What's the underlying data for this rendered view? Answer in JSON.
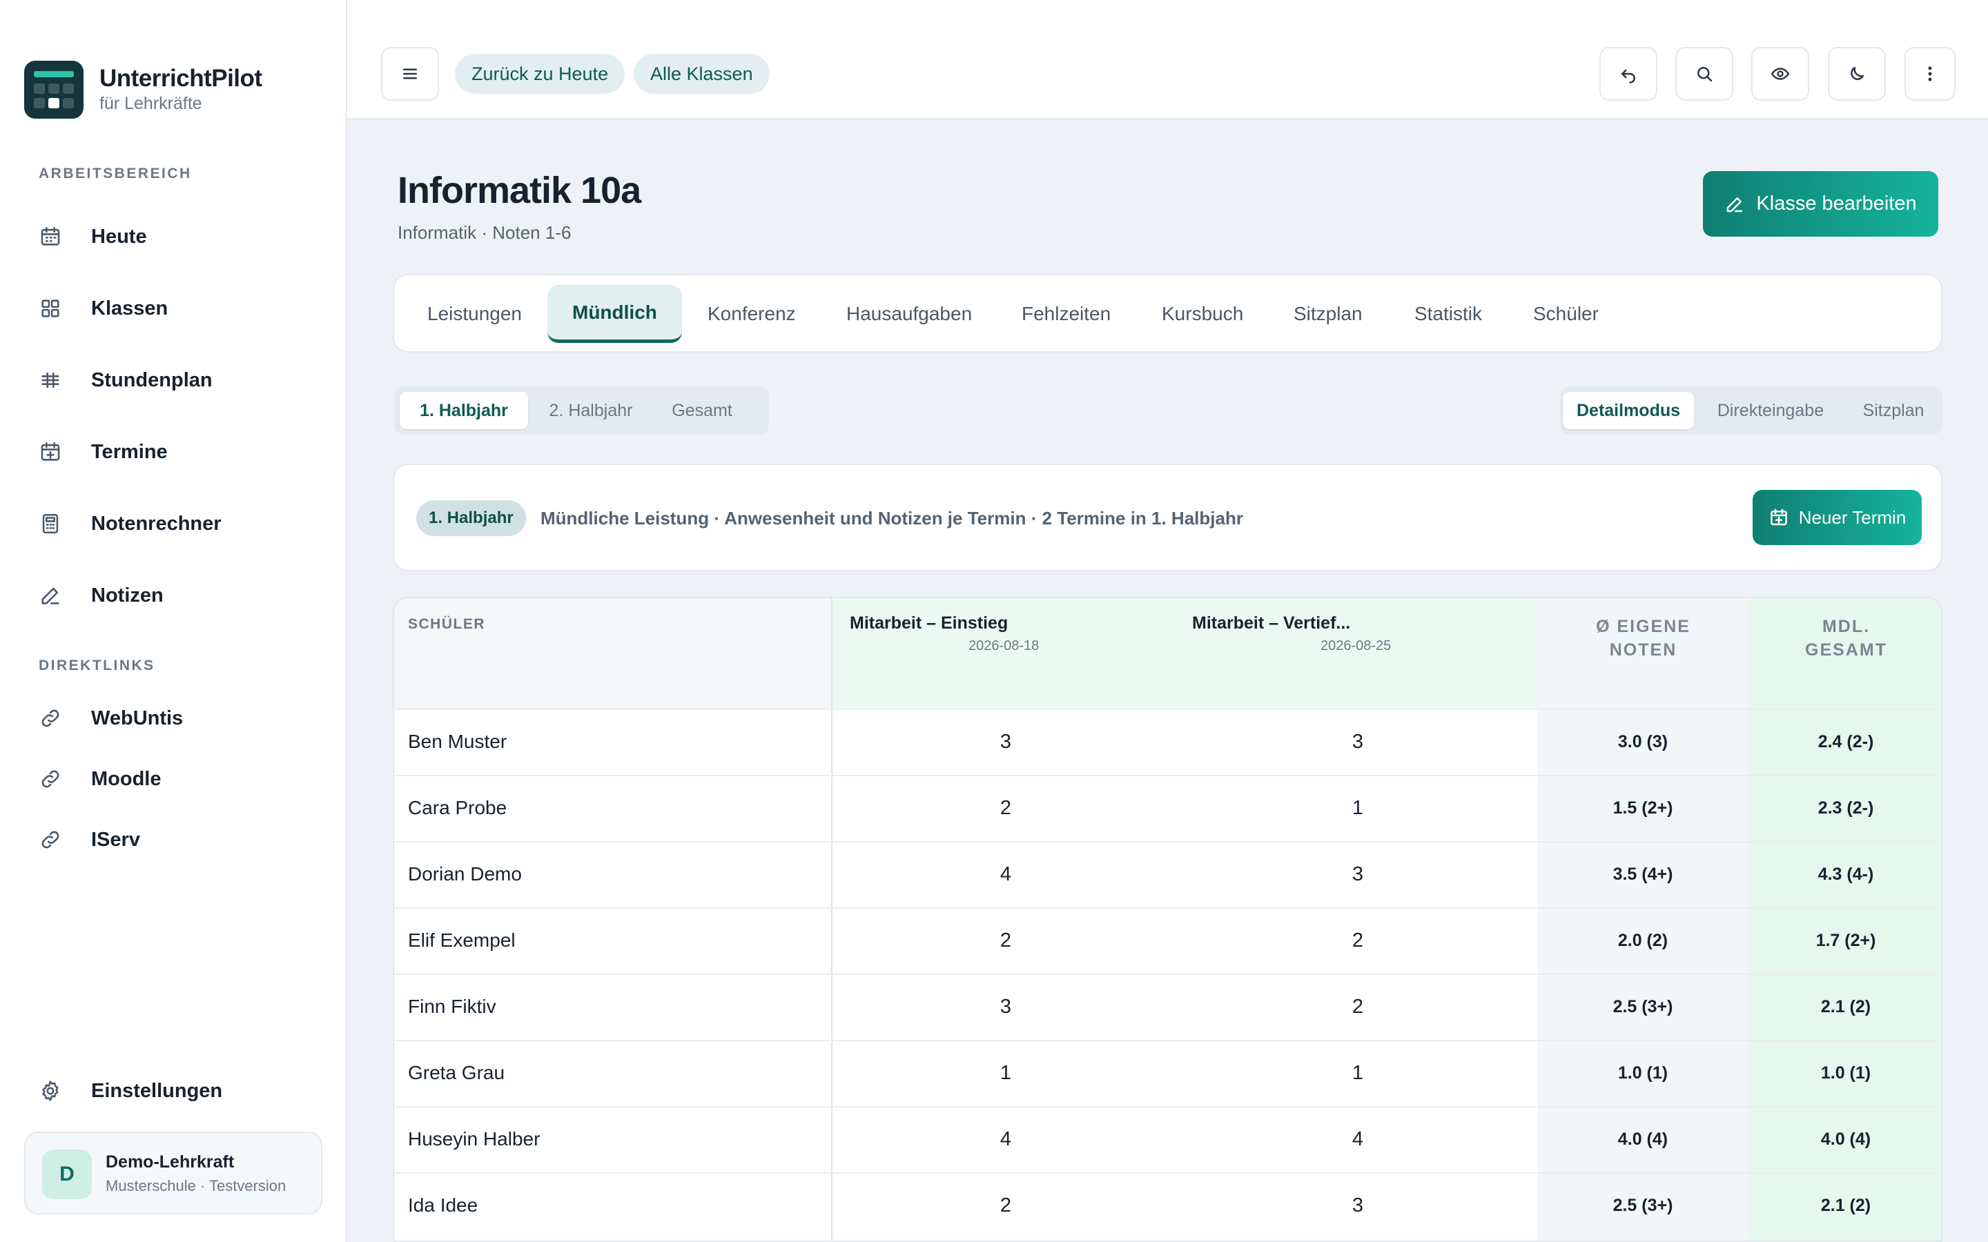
{
  "app": {
    "title": "UnterrichtPilot",
    "subtitle": "für Lehrkräfte"
  },
  "sidebar": {
    "section_work": "ARBEITSBEREICH",
    "items": [
      {
        "label": "Heute",
        "icon": "calendar-icon"
      },
      {
        "label": "Klassen",
        "icon": "grid-icon"
      },
      {
        "label": "Stundenplan",
        "icon": "timetable-icon"
      },
      {
        "label": "Termine",
        "icon": "calendar-plus-icon"
      },
      {
        "label": "Notenrechner",
        "icon": "calculator-icon"
      },
      {
        "label": "Notizen",
        "icon": "pencil-icon"
      }
    ],
    "section_links": "DIREKTLINKS",
    "links": [
      {
        "label": "WebUntis",
        "icon": "link-icon"
      },
      {
        "label": "Moodle",
        "icon": "link-icon"
      },
      {
        "label": "IServ",
        "icon": "link-icon"
      }
    ],
    "settings_label": "Einstellungen",
    "user": {
      "initial": "D",
      "name": "Demo-Lehrkraft",
      "sub": "Musterschule · Testversion"
    }
  },
  "topbar": {
    "back_today": "Zurück zu Heute",
    "all_classes": "Alle Klassen",
    "icons": [
      "menu-icon",
      "undo-icon",
      "search-icon",
      "eye-icon",
      "moon-icon",
      "more-vertical-icon"
    ]
  },
  "page": {
    "title": "Informatik 10a",
    "subtitle": "Informatik · Noten 1-6",
    "edit_button": "Klasse bearbeiten"
  },
  "tabs": [
    "Leistungen",
    "Mündlich",
    "Konferenz",
    "Hausaufgaben",
    "Fehlzeiten",
    "Kursbuch",
    "Sitzplan",
    "Statistik",
    "Schüler"
  ],
  "active_tab": "Mündlich",
  "halfyear": {
    "options": [
      "1. Halbjahr",
      "2. Halbjahr",
      "Gesamt"
    ],
    "selected": "1. Halbjahr"
  },
  "modes": {
    "options": [
      "Detailmodus",
      "Direkteingabe",
      "Sitzplan"
    ],
    "selected": "Detailmodus"
  },
  "info": {
    "badge": "1. Halbjahr",
    "text": "Mündliche Leistung · Anwesenheit und Notizen je Termin · 2 Termine in 1. Halbjahr",
    "new_button": "Neuer Termin"
  },
  "table": {
    "name_header": "SCHÜLER",
    "terms": [
      {
        "title": "Mitarbeit – Einstieg",
        "date": "2026-08-18"
      },
      {
        "title": "Mitarbeit – Vertief...",
        "date": "2026-08-25"
      }
    ],
    "avg_header_1": "Ø EIGENE",
    "avg_header_2": "NOTEN",
    "total_header_1": "MDL.",
    "total_header_2": "GESAMT",
    "rows": [
      {
        "name": "Ben Muster",
        "g1": "3",
        "g2": "3",
        "avg": "3.0 (3)",
        "total": "2.4 (2-)"
      },
      {
        "name": "Cara Probe",
        "g1": "2",
        "g2": "1",
        "avg": "1.5 (2+)",
        "total": "2.3 (2-)"
      },
      {
        "name": "Dorian Demo",
        "g1": "4",
        "g2": "3",
        "avg": "3.5 (4+)",
        "total": "4.3 (4-)"
      },
      {
        "name": "Elif Exempel",
        "g1": "2",
        "g2": "2",
        "avg": "2.0 (2)",
        "total": "1.7 (2+)"
      },
      {
        "name": "Finn Fiktiv",
        "g1": "3",
        "g2": "2",
        "avg": "2.5 (3+)",
        "total": "2.1 (2)"
      },
      {
        "name": "Greta Grau",
        "g1": "1",
        "g2": "1",
        "avg": "1.0 (1)",
        "total": "1.0 (1)"
      },
      {
        "name": "Huseyin Halber",
        "g1": "4",
        "g2": "4",
        "avg": "4.0 (4)",
        "total": "4.0 (4)"
      },
      {
        "name": "Ida Idee",
        "g1": "2",
        "g2": "3",
        "avg": "2.5 (3+)",
        "total": "2.1 (2)"
      }
    ]
  },
  "colors": {
    "accent": "#0f7f72",
    "accent_light": "#16b39b",
    "sidebar_bg": "#ffffff",
    "content_bg": "#eef2f6",
    "term_col_bg": "#eafaf2"
  }
}
